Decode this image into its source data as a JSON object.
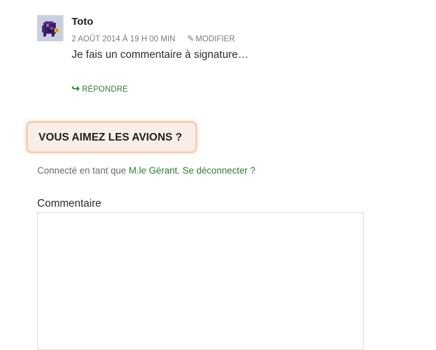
{
  "comment": {
    "author": "Toto",
    "date": "2 AOÛT 2014 À 19 H 00 MIN",
    "edit_label": "MODIFIER",
    "text": "Je fais un commentaire à signature…",
    "reply_label": "RÉPONDRE",
    "avatar_icon": "pixel-avatar-icon"
  },
  "form": {
    "heading": "VOUS AIMEZ LES AVIONS ?",
    "logged_prefix": "Connecté en tant que ",
    "user_link": "M.le Gérant",
    "separator": ". ",
    "logout_link": "Se déconnecter ?",
    "comment_label": "Commentaire",
    "comment_value": ""
  },
  "colors": {
    "link_green": "#2e7d2e",
    "heading_bg": "#f8eee7",
    "heading_border": "#f0c8a4"
  }
}
